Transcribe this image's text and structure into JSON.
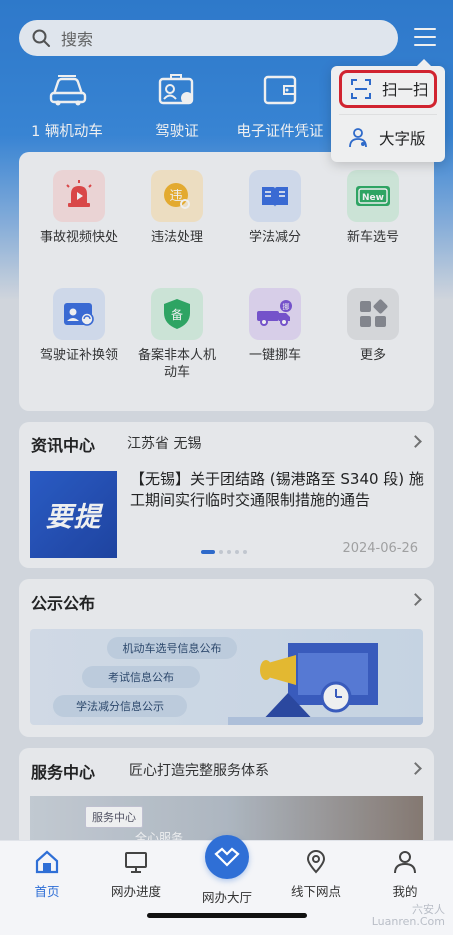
{
  "search": {
    "placeholder": "搜索"
  },
  "quick_actions": [
    {
      "label": "1 辆机动车",
      "icon": "car-icon"
    },
    {
      "label": "驾驶证",
      "icon": "license-icon"
    },
    {
      "label": "电子证件凭证",
      "icon": "wallet-icon"
    }
  ],
  "popup_menu": [
    {
      "label": "扫一扫",
      "icon": "scan-icon",
      "highlight_color": "#e0232f"
    },
    {
      "label": "大字版",
      "icon": "person-icon"
    }
  ],
  "services": [
    {
      "label": "事故视频快处",
      "icon": "siren-icon"
    },
    {
      "label": "违法处理",
      "icon": "violation-icon"
    },
    {
      "label": "学法减分",
      "icon": "book-icon"
    },
    {
      "label": "新车选号",
      "icon": "new-plate-icon"
    },
    {
      "label": "驾驶证补换领",
      "icon": "id-card-icon"
    },
    {
      "label": "备案非本人机动车",
      "icon": "shield-icon"
    },
    {
      "label": "一键挪车",
      "icon": "truck-icon"
    },
    {
      "label": "更多",
      "icon": "more-icon"
    }
  ],
  "news": {
    "title": "资讯中心",
    "location": "江苏省 无锡",
    "image_text": "要提",
    "headline": "【无锡】关于团结路 (锡港路至 S340 段) 施工期间实行临时交通限制措施的通告",
    "date": "2024-06-26"
  },
  "notice": {
    "title": "公示公布",
    "pills": [
      "机动车选号信息公布",
      "考试信息公布",
      "学法减分信息公示"
    ]
  },
  "service_center": {
    "title": "服务中心",
    "subtitle": "匠心打造完整服务体系",
    "tag": "服务中心",
    "tag2": "全心服务"
  },
  "tabbar": [
    {
      "label": "首页",
      "icon": "home-icon",
      "active": true
    },
    {
      "label": "网办进度",
      "icon": "monitor-icon"
    },
    {
      "label": "网办大厅",
      "icon": "handshake-icon"
    },
    {
      "label": "线下网点",
      "icon": "location-icon"
    },
    {
      "label": "我的",
      "icon": "user-icon"
    }
  ],
  "watermark": {
    "line1": "六安人",
    "line2": "Luanren.Com"
  },
  "colors": {
    "brand_blue": "#2f6fd6",
    "highlight_red": "#e0232f"
  }
}
